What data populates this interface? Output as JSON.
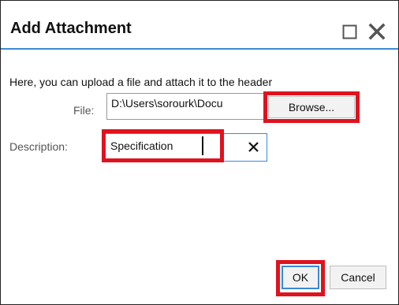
{
  "dialog": {
    "title": "Add Attachment",
    "intro": "Here, you can upload a file and attach it to the header",
    "maximize_icon": "maximize-icon",
    "close_icon": "close-icon"
  },
  "file": {
    "label": "File:",
    "value": "D:\\Users\\sorourk\\Docu",
    "browse_label": "Browse..."
  },
  "description": {
    "label": "Description:",
    "value": "Specification",
    "clear_icon": "clear-icon"
  },
  "footer": {
    "ok_label": "OK",
    "cancel_label": "Cancel"
  },
  "colors": {
    "accent": "#3a8ad6",
    "highlight": "#e0121e",
    "button_bg": "#f2f2f2",
    "label_text": "#555555"
  }
}
